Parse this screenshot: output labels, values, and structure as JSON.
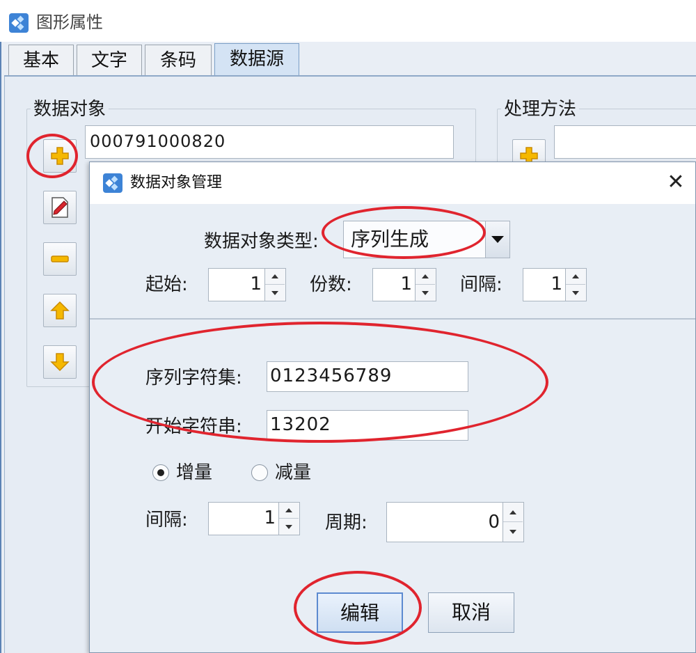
{
  "outer_window": {
    "title": "图形属性",
    "tabs": [
      {
        "label": "基本",
        "active": false
      },
      {
        "label": "文字",
        "active": false
      },
      {
        "label": "条码",
        "active": false
      },
      {
        "label": "数据源",
        "active": true
      }
    ],
    "data_object_group": {
      "label": "数据对象",
      "items": [
        "000791000820"
      ],
      "buttons": {
        "add": "plus-icon",
        "edit": "edit-icon",
        "remove": "minus-icon",
        "move_up": "arrow-up-icon",
        "move_down": "arrow-down-icon"
      }
    },
    "process_method_group": {
      "label": "处理方法"
    }
  },
  "dialog": {
    "title": "数据对象管理",
    "close_label": "✕",
    "type": {
      "label": "数据对象类型:",
      "value": "序列生成"
    },
    "start": {
      "label": "起始:",
      "value": "1"
    },
    "copies": {
      "label": "份数:",
      "value": "1"
    },
    "interval_top": {
      "label": "间隔:",
      "value": "1"
    },
    "charset": {
      "label": "序列字符集:",
      "value": "0123456789"
    },
    "start_string": {
      "label": "开始字符串:",
      "value": "13202"
    },
    "direction": {
      "increment": {
        "label": "增量",
        "checked": true
      },
      "decrement": {
        "label": "减量",
        "checked": false
      }
    },
    "interval": {
      "label": "间隔:",
      "value": "1"
    },
    "period": {
      "label": "周期:",
      "value": "0"
    },
    "buttons": {
      "edit": "编辑",
      "cancel": "取消"
    }
  },
  "colors": {
    "annotation_red": "#e0242e",
    "window_bg": "#e6ecf4",
    "active_tab": "#d4e3f4",
    "icon_yellow": "#f5b800"
  }
}
